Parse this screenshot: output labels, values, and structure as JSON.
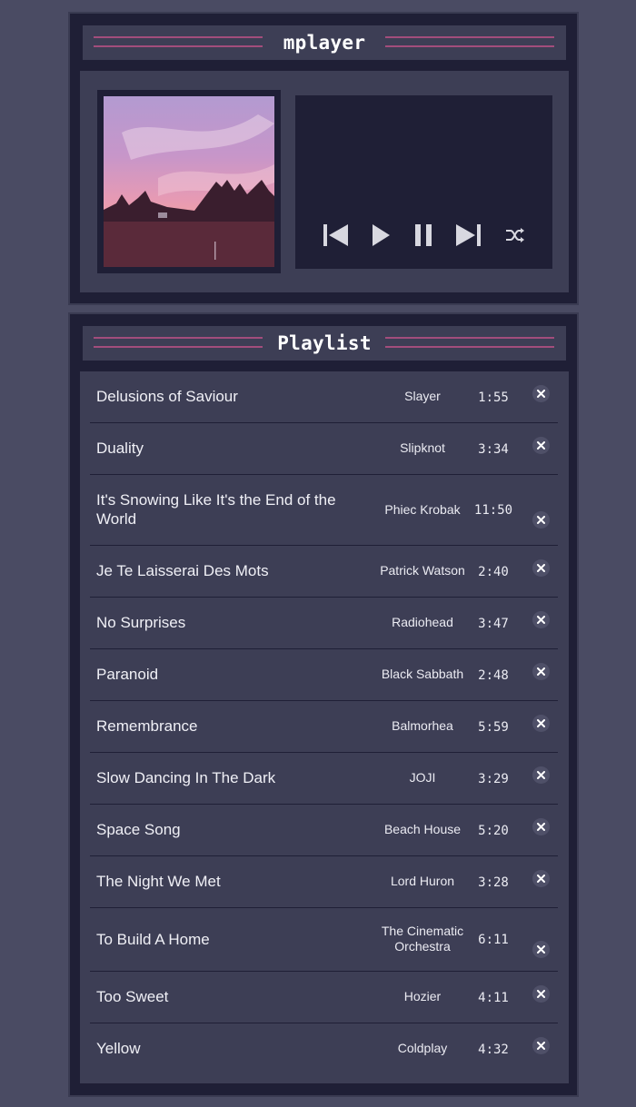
{
  "player": {
    "title": "mplayer",
    "album_art_alt": "album art",
    "controls": [
      {
        "name": "previous-button",
        "icon": "skip-previous-icon"
      },
      {
        "name": "play-button",
        "icon": "play-icon"
      },
      {
        "name": "pause-button",
        "icon": "pause-icon"
      },
      {
        "name": "next-button",
        "icon": "skip-next-icon"
      },
      {
        "name": "shuffle-button",
        "icon": "shuffle-icon"
      }
    ]
  },
  "playlist": {
    "title": "Playlist",
    "tracks": [
      {
        "title": "Delusions of Saviour",
        "artist": "Slayer",
        "duration": "1:55"
      },
      {
        "title": "Duality",
        "artist": "Slipknot",
        "duration": "3:34"
      },
      {
        "title": "It's Snowing Like It's the End of the World",
        "artist": "Phiec Krobak",
        "duration": "11:50"
      },
      {
        "title": "Je Te Laisserai Des Mots",
        "artist": "Patrick Watson",
        "duration": "2:40"
      },
      {
        "title": "No Surprises",
        "artist": "Radiohead",
        "duration": "3:47"
      },
      {
        "title": "Paranoid",
        "artist": "Black Sabbath",
        "duration": "2:48"
      },
      {
        "title": "Remembrance",
        "artist": "Balmorhea",
        "duration": "5:59"
      },
      {
        "title": "Slow Dancing In The Dark",
        "artist": "JOJI",
        "duration": "3:29"
      },
      {
        "title": "Space Song",
        "artist": "Beach House",
        "duration": "5:20"
      },
      {
        "title": "The Night We Met",
        "artist": "Lord Huron",
        "duration": "3:28"
      },
      {
        "title": "To Build A Home",
        "artist": "The Cinematic Orchestra",
        "duration": "6:11"
      },
      {
        "title": "Too Sweet",
        "artist": "Hozier",
        "duration": "4:11"
      },
      {
        "title": "Yellow",
        "artist": "Coldplay",
        "duration": "4:32"
      }
    ]
  },
  "colors": {
    "background": "#4a4b63",
    "panel": "#1f1f36",
    "inner": "#3d3e55",
    "accent": "#a24d7c",
    "text": "#f0f0f6"
  }
}
